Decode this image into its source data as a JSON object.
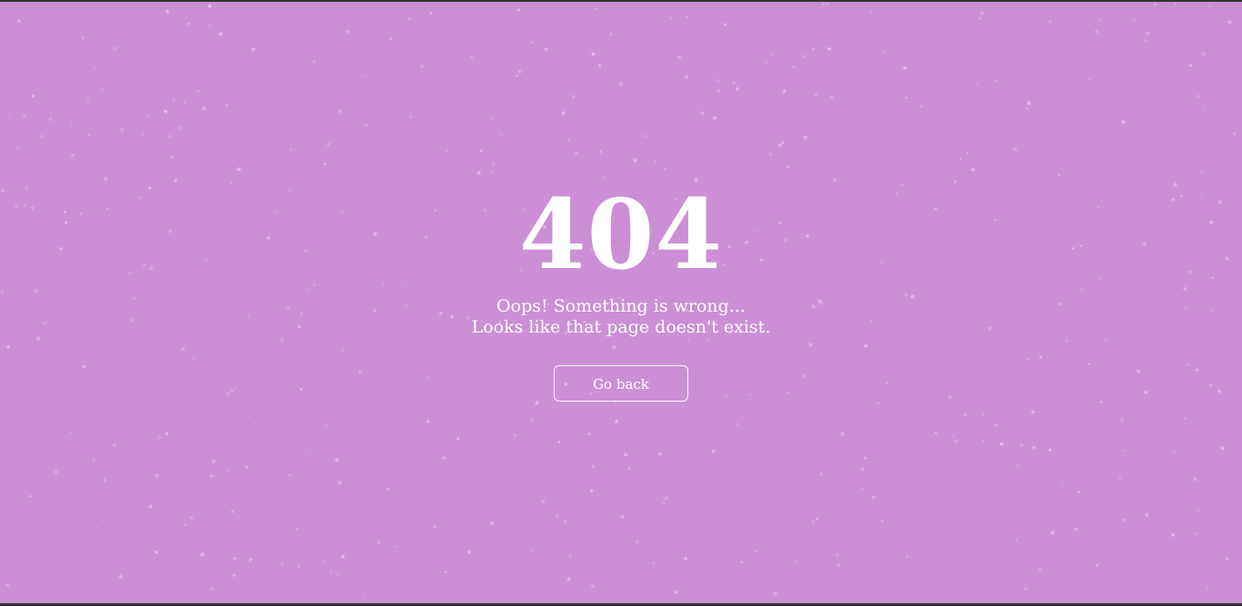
{
  "theme": {
    "background": "#cc8fd6",
    "text_color": "#ffffff",
    "star_color": "#ffffff"
  },
  "error": {
    "code": "404",
    "message_line1": "Oops! Something is wrong...",
    "message_line2": "Looks like that page doesn't exist."
  },
  "actions": {
    "go_back_label": "Go back"
  },
  "decor": {
    "star_glyph": "★",
    "star_count": 420
  }
}
